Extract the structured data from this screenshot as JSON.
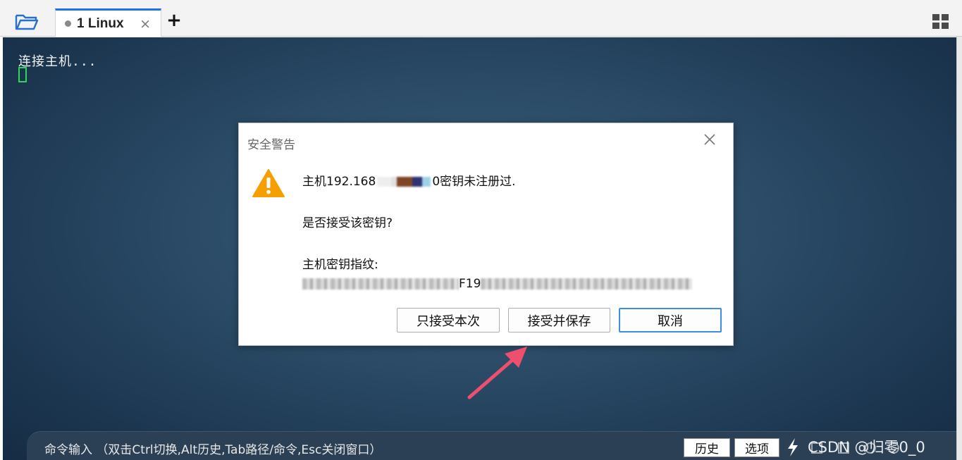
{
  "tabbar": {
    "tab_label": "1 Linux",
    "close_glyph": "×",
    "add_glyph": "+"
  },
  "terminal": {
    "line1": "连接主机..."
  },
  "dialog": {
    "title": "安全警告",
    "msg_prefix": "主机192.168",
    "msg_suffix": "0密钥未注册过.",
    "question": "是否接受该密钥?",
    "fp_label": "主机密钥指纹:",
    "fp_visible": "F19",
    "buttons": {
      "accept_once": "只接受本次",
      "accept_save": "接受并保存",
      "cancel": "取消"
    }
  },
  "cmdbar": {
    "hint": "命令输入 （双击Ctrl切换,Alt历史,Tab路径/命令,Esc关闭窗口）",
    "history": "历史",
    "options": "选项",
    "watermark": "CSDN @归零0_0"
  },
  "colors": {
    "accent": "#1a73e8",
    "warning": "#f5a000",
    "cursor": "#2fd65a",
    "arrow": "#ef4f6e"
  }
}
